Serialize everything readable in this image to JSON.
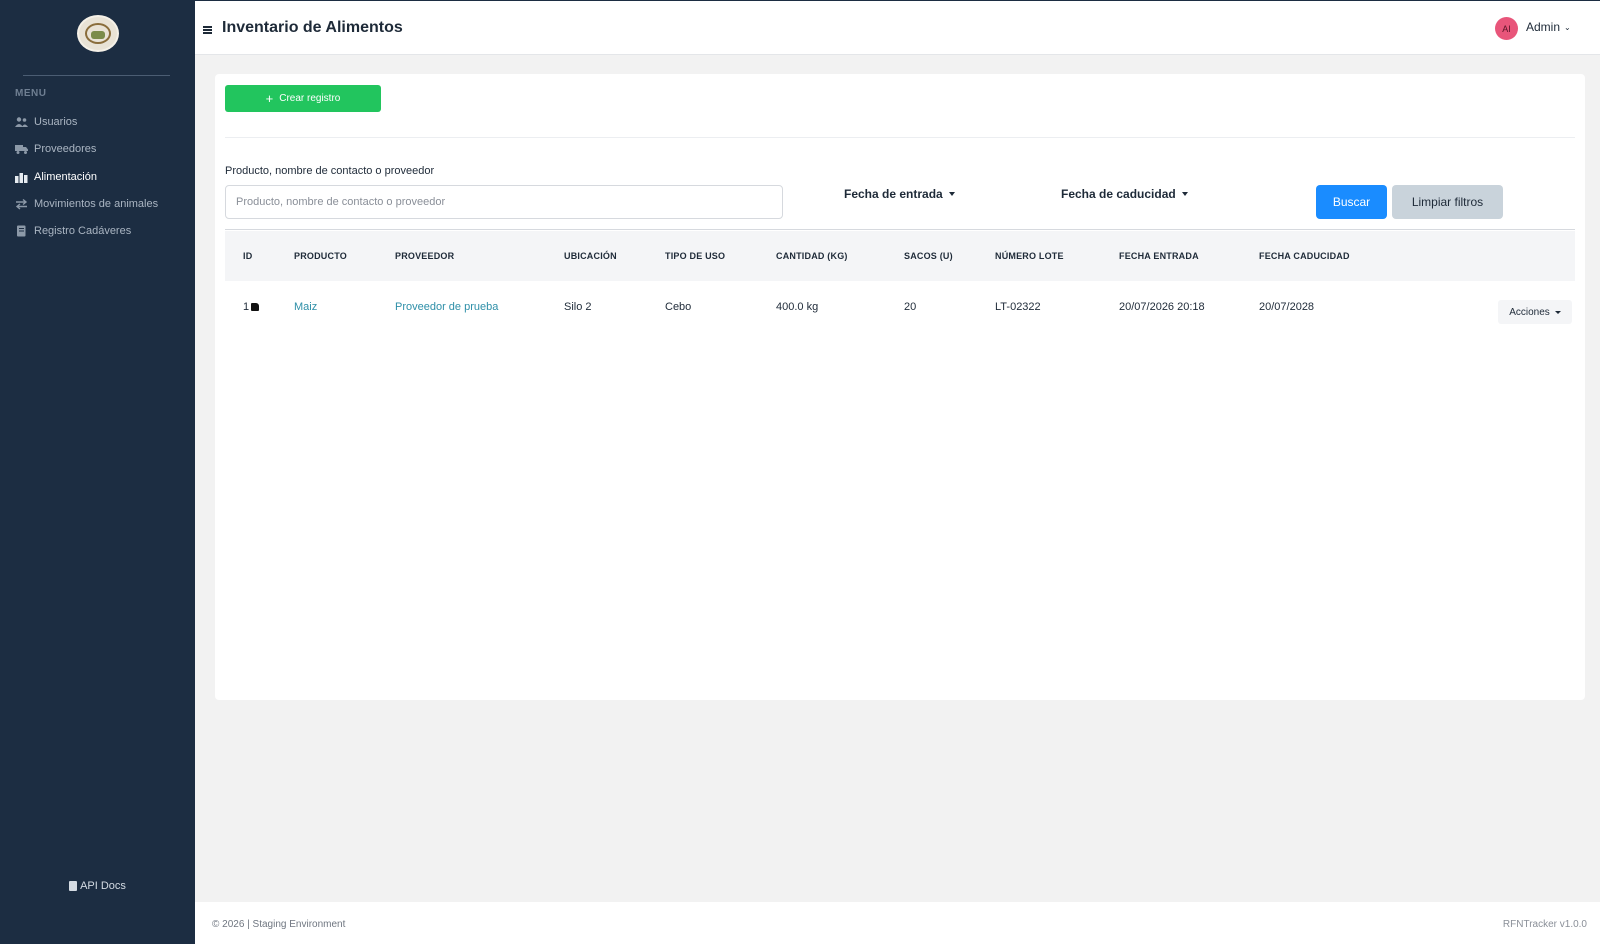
{
  "sidebar": {
    "menu_label": "MENU",
    "items": [
      {
        "label": "Usuarios",
        "icon": "users-icon",
        "active": false
      },
      {
        "label": "Proveedores",
        "icon": "truck-icon",
        "active": false
      },
      {
        "label": "Alimentación",
        "icon": "food-icon",
        "active": true
      },
      {
        "label": "Movimientos de animales",
        "icon": "arrows-icon",
        "active": false
      },
      {
        "label": "Registro Cadáveres",
        "icon": "book-icon",
        "active": false
      }
    ],
    "api_docs": "API Docs"
  },
  "header": {
    "title": "Inventario de Alimentos",
    "avatar_initials": "AI",
    "user_name": "Admin"
  },
  "toolbar": {
    "create_label": "Crear registro"
  },
  "filters": {
    "search_label": "Producto, nombre de contacto o proveedor",
    "search_placeholder": "Producto, nombre de contacto o proveedor",
    "search_value": "",
    "entry_date_label": "Fecha de entrada",
    "expiry_date_label": "Fecha de caducidad",
    "search_button": "Buscar",
    "clear_button": "Limpiar filtros"
  },
  "table": {
    "columns": [
      "ID",
      "PRODUCTO",
      "PROVEEDOR",
      "UBICACIÓN",
      "TIPO DE USO",
      "CANTIDAD (KG)",
      "SACOS (U)",
      "NÚMERO LOTE",
      "FECHA ENTRADA",
      "FECHA CADUCIDAD"
    ],
    "rows": [
      {
        "id": "1",
        "producto": "Maiz",
        "proveedor": "Proveedor de prueba",
        "ubicacion": "Silo 2",
        "tipo_uso": "Cebo",
        "cantidad": "400.0 kg",
        "sacos": "20",
        "lote": "LT-02322",
        "fecha_entrada": "20/07/2026 20:18",
        "fecha_caducidad": "20/07/2028",
        "actions_label": "Acciones"
      }
    ]
  },
  "footer": {
    "left": "© 2026 | Staging Environment",
    "right": "RFNTracker v1.0.0"
  },
  "colors": {
    "sidebar_bg": "#1c2d42",
    "create_button": "#22c55e",
    "search_button": "#1a8cff",
    "clear_button": "#c9d3db",
    "link": "#2e8fa8",
    "avatar": "#e8557a"
  }
}
